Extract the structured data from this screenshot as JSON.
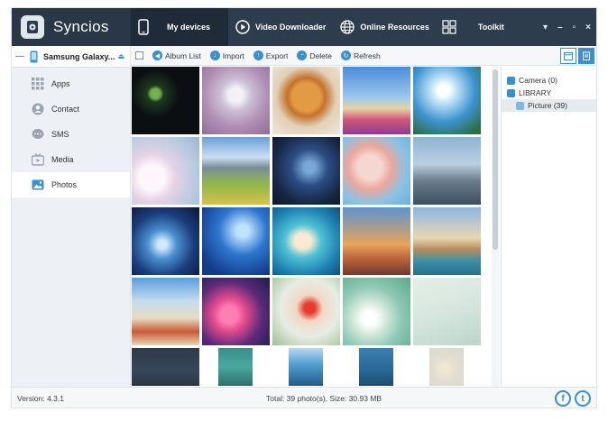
{
  "app": {
    "name": "Syncios"
  },
  "nav": {
    "my_devices": "My devices",
    "video_downloader": "Video Downloader",
    "online_resources": "Online Resources",
    "toolkit": "Toolkit"
  },
  "window_controls": {
    "menu": "▾",
    "minimize": "–",
    "maximize": "▫",
    "close": "×"
  },
  "device": {
    "name": "Samsung Galaxy..."
  },
  "sidebar": {
    "items": [
      {
        "label": "Apps",
        "icon": "apps-grid-icon"
      },
      {
        "label": "Contact",
        "icon": "contact-icon"
      },
      {
        "label": "SMS",
        "icon": "sms-icon"
      },
      {
        "label": "Media",
        "icon": "media-icon"
      },
      {
        "label": "Photos",
        "icon": "photos-icon",
        "active": true
      }
    ]
  },
  "toolbar": {
    "album_list": "Album List",
    "import": "Import",
    "export": "Export",
    "delete": "Delete",
    "refresh": "Refresh"
  },
  "tree": {
    "camera": "Camera (0)",
    "library": "LIBRARY",
    "picture": "Picture (39)"
  },
  "status": {
    "version": "Version: 4.3.1",
    "total": "Total: 39 photo(s), Size: 30.93 MB"
  },
  "social": {
    "facebook": "f",
    "twitter": "t"
  },
  "colors": {
    "accent": "#3a8fd0",
    "topbar": "#2e3d4e",
    "sidebar": "#edf1f5"
  },
  "photos": [
    "dark-orb",
    "apple-logo",
    "teddy-bear",
    "blue-sky-clouds",
    "dandelion",
    "white-flowers",
    "mountain-meadow",
    "night-tree",
    "cherry-blossom",
    "city-tower",
    "galaxy",
    "blue-forest",
    "tropical-reef",
    "tv-tower",
    "venice",
    "boat-beach",
    "pink-flowers",
    "red-flowers",
    "green-wave",
    "pastel-abstract",
    "sunset-coast",
    "teal-water",
    "island",
    "ocean",
    "pale-shell"
  ]
}
